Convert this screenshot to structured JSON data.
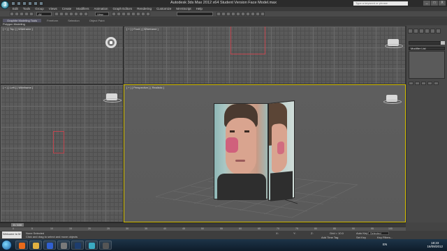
{
  "window": {
    "title": "Autodesk 3ds Max 2012 x64    Student Version    Face Model.max",
    "search_placeholder": "Type a keyword or phrase",
    "min": "_",
    "max": "□",
    "close": "X"
  },
  "menu": [
    "Edit",
    "Tools",
    "Group",
    "Views",
    "Create",
    "Modifiers",
    "Animation",
    "Graph Editors",
    "Rendering",
    "Customize",
    "MAXScript",
    "Help"
  ],
  "toolbar": {
    "selection_filter": "All",
    "named_selection": "",
    "view_dropdown": "View"
  },
  "ribbon": {
    "tabs": [
      "Graphite Modeling Tools",
      "Freeform",
      "Selection",
      "Object Paint"
    ],
    "sublabel": "Polygon Modeling"
  },
  "viewports": {
    "top_label": "[ + ] [ Top ] [ Wireframe ]",
    "front_label": "[ + ] [ Front ] [ Wireframe ]",
    "left_label": "[ + ] [ Left ] [ Wireframe ]",
    "persp_label": "[ + ] [ Perspective ] [ Realistic ]"
  },
  "command_panel": {
    "name_field": "",
    "modifier_list": "Modifier List"
  },
  "timeline": {
    "slider_label": "0 / 100",
    "ticks": [
      "0",
      "5",
      "10",
      "15",
      "20",
      "25",
      "30",
      "35",
      "40",
      "45",
      "50",
      "55",
      "60",
      "65",
      "70",
      "75",
      "80",
      "85",
      "90",
      "95",
      "100"
    ]
  },
  "status": {
    "maxscript": "Welcome to M",
    "line1": "None Selected",
    "line2": "Click and drag to select and move objects",
    "x_label": "X:",
    "y_label": "Y:",
    "z_label": "Z:",
    "grid": "Grid = 10.0",
    "add_time_tag": "Add Time Tag",
    "auto_key": "Auto Key",
    "selected": "Selected",
    "set_key": "Set Key",
    "key_filters": "Key Filters..."
  },
  "taskbar": {
    "lang": "EN",
    "time": "18:23",
    "date": "16/09/2012"
  },
  "colors": {
    "selection_outline": "#c0454e",
    "active_viewport_border": "#d6c000"
  }
}
